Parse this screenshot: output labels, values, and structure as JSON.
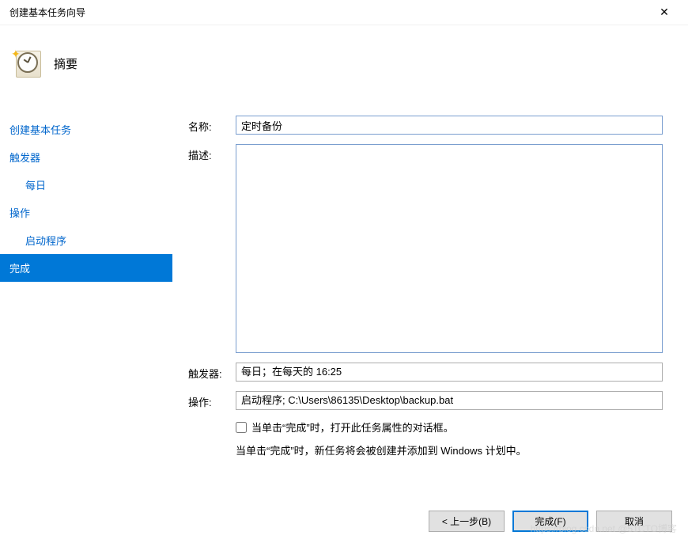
{
  "window": {
    "title": "创建基本任务向导",
    "close_glyph": "✕"
  },
  "header": {
    "title": "摘要"
  },
  "sidebar": {
    "items": [
      {
        "label": "创建基本任务",
        "sub": false,
        "selected": false
      },
      {
        "label": "触发器",
        "sub": false,
        "selected": false
      },
      {
        "label": "每日",
        "sub": true,
        "selected": false
      },
      {
        "label": "操作",
        "sub": false,
        "selected": false
      },
      {
        "label": "启动程序",
        "sub": true,
        "selected": false
      },
      {
        "label": "完成",
        "sub": false,
        "selected": true
      }
    ]
  },
  "form": {
    "name_label": "名称:",
    "name_value": "定时备份",
    "desc_label": "描述:",
    "desc_value": "",
    "trigger_label": "触发器:",
    "trigger_value": "每日；在每天的 16:25",
    "action_label": "操作:",
    "action_value": "启动程序; C:\\Users\\86135\\Desktop\\backup.bat",
    "open_props_label": "当单击“完成”时，打开此任务属性的对话框。",
    "info_text": "当单击“完成”时，新任务将会被创建并添加到 Windows 计划中。"
  },
  "footer": {
    "back": "< 上一步(B)",
    "finish": "完成(F)",
    "cancel": "取消"
  },
  "watermark": "https://blog.csdn.net @51CTO博客"
}
